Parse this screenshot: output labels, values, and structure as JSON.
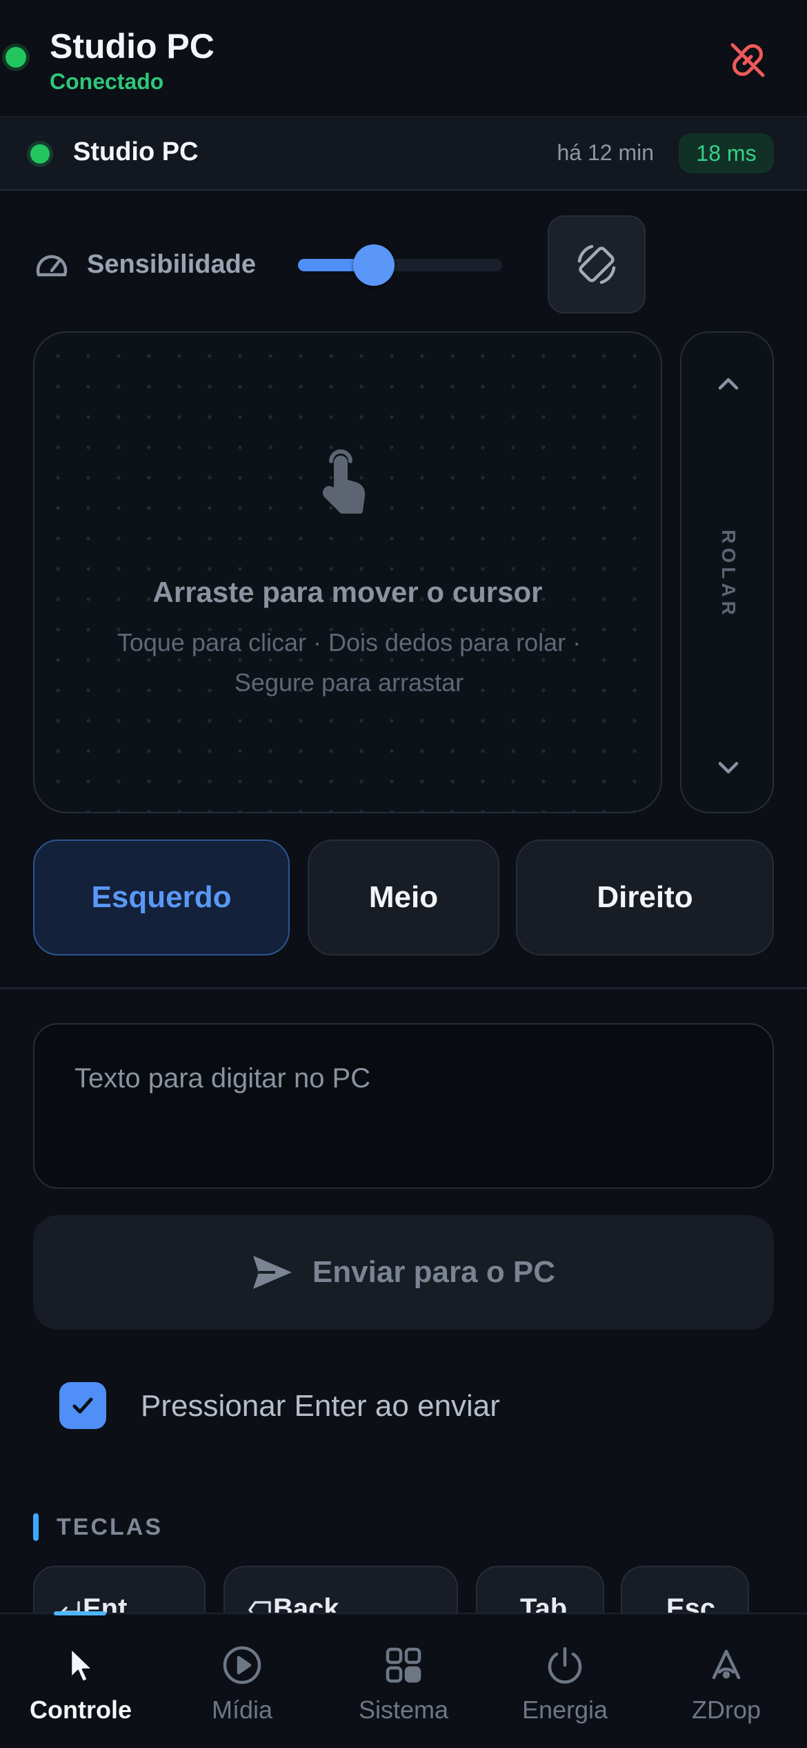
{
  "header": {
    "title": "Studio PC",
    "status": "Conectado",
    "disconnect_icon": "link-broken-icon"
  },
  "device": {
    "name": "Studio PC",
    "last_seen": "há 12 min",
    "latency": "18 ms"
  },
  "sensitivity": {
    "label": "Sensibilidade",
    "value": 0.37
  },
  "touchpad": {
    "title": "Arraste para mover o cursor",
    "hint": "Toque para clicar · Dois dedos para rolar · Segure para arrastar"
  },
  "scroll": {
    "label": "ROLAR"
  },
  "mouse_buttons": {
    "left": "Esquerdo",
    "middle": "Meio",
    "right": "Direito",
    "active": "left"
  },
  "text_input": {
    "placeholder": "Texto para digitar no PC",
    "value": ""
  },
  "send_button": {
    "label": "Enviar para o PC"
  },
  "enter_option": {
    "label": "Pressionar Enter ao enviar",
    "checked": true
  },
  "keys_section": {
    "title": "TECLAS",
    "keys": [
      "Ent",
      "Back",
      "Tab",
      "Esc"
    ]
  },
  "bottom_nav": {
    "items": [
      {
        "label": "Controle",
        "icon": "cursor-icon",
        "active": true
      },
      {
        "label": "Mídia",
        "icon": "play-circle-icon",
        "active": false
      },
      {
        "label": "Sistema",
        "icon": "grid-icon",
        "active": false
      },
      {
        "label": "Energia",
        "icon": "power-icon",
        "active": false
      },
      {
        "label": "ZDrop",
        "icon": "zdrop-icon",
        "active": false
      }
    ]
  },
  "colors": {
    "accent": "#4f8ff7",
    "connected": "#22c55e",
    "disconnect": "#ef5350",
    "background": "#0c0f15"
  }
}
